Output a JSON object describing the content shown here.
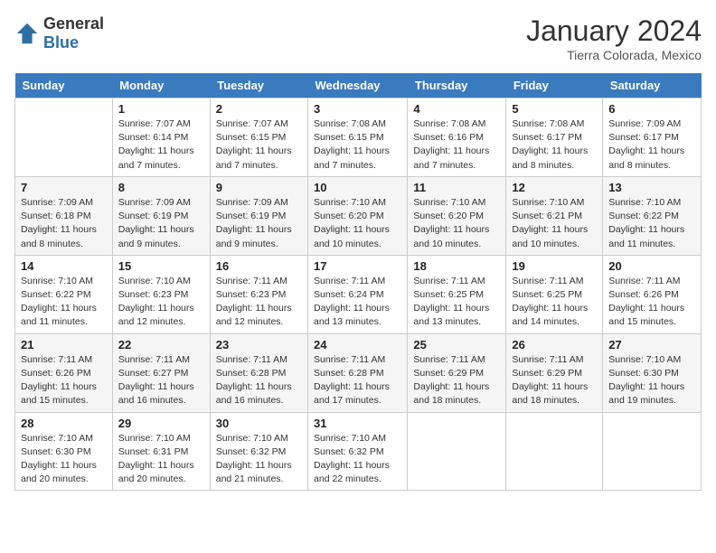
{
  "header": {
    "logo_general": "General",
    "logo_blue": "Blue",
    "month_year": "January 2024",
    "location": "Tierra Colorada, Mexico"
  },
  "weekdays": [
    "Sunday",
    "Monday",
    "Tuesday",
    "Wednesday",
    "Thursday",
    "Friday",
    "Saturday"
  ],
  "weeks": [
    [
      {
        "day": "",
        "info": ""
      },
      {
        "day": "1",
        "info": "Sunrise: 7:07 AM\nSunset: 6:14 PM\nDaylight: 11 hours\nand 7 minutes."
      },
      {
        "day": "2",
        "info": "Sunrise: 7:07 AM\nSunset: 6:15 PM\nDaylight: 11 hours\nand 7 minutes."
      },
      {
        "day": "3",
        "info": "Sunrise: 7:08 AM\nSunset: 6:15 PM\nDaylight: 11 hours\nand 7 minutes."
      },
      {
        "day": "4",
        "info": "Sunrise: 7:08 AM\nSunset: 6:16 PM\nDaylight: 11 hours\nand 7 minutes."
      },
      {
        "day": "5",
        "info": "Sunrise: 7:08 AM\nSunset: 6:17 PM\nDaylight: 11 hours\nand 8 minutes."
      },
      {
        "day": "6",
        "info": "Sunrise: 7:09 AM\nSunset: 6:17 PM\nDaylight: 11 hours\nand 8 minutes."
      }
    ],
    [
      {
        "day": "7",
        "info": "Sunrise: 7:09 AM\nSunset: 6:18 PM\nDaylight: 11 hours\nand 8 minutes."
      },
      {
        "day": "8",
        "info": "Sunrise: 7:09 AM\nSunset: 6:19 PM\nDaylight: 11 hours\nand 9 minutes."
      },
      {
        "day": "9",
        "info": "Sunrise: 7:09 AM\nSunset: 6:19 PM\nDaylight: 11 hours\nand 9 minutes."
      },
      {
        "day": "10",
        "info": "Sunrise: 7:10 AM\nSunset: 6:20 PM\nDaylight: 11 hours\nand 10 minutes."
      },
      {
        "day": "11",
        "info": "Sunrise: 7:10 AM\nSunset: 6:20 PM\nDaylight: 11 hours\nand 10 minutes."
      },
      {
        "day": "12",
        "info": "Sunrise: 7:10 AM\nSunset: 6:21 PM\nDaylight: 11 hours\nand 10 minutes."
      },
      {
        "day": "13",
        "info": "Sunrise: 7:10 AM\nSunset: 6:22 PM\nDaylight: 11 hours\nand 11 minutes."
      }
    ],
    [
      {
        "day": "14",
        "info": "Sunrise: 7:10 AM\nSunset: 6:22 PM\nDaylight: 11 hours\nand 11 minutes."
      },
      {
        "day": "15",
        "info": "Sunrise: 7:10 AM\nSunset: 6:23 PM\nDaylight: 11 hours\nand 12 minutes."
      },
      {
        "day": "16",
        "info": "Sunrise: 7:11 AM\nSunset: 6:23 PM\nDaylight: 11 hours\nand 12 minutes."
      },
      {
        "day": "17",
        "info": "Sunrise: 7:11 AM\nSunset: 6:24 PM\nDaylight: 11 hours\nand 13 minutes."
      },
      {
        "day": "18",
        "info": "Sunrise: 7:11 AM\nSunset: 6:25 PM\nDaylight: 11 hours\nand 13 minutes."
      },
      {
        "day": "19",
        "info": "Sunrise: 7:11 AM\nSunset: 6:25 PM\nDaylight: 11 hours\nand 14 minutes."
      },
      {
        "day": "20",
        "info": "Sunrise: 7:11 AM\nSunset: 6:26 PM\nDaylight: 11 hours\nand 15 minutes."
      }
    ],
    [
      {
        "day": "21",
        "info": "Sunrise: 7:11 AM\nSunset: 6:26 PM\nDaylight: 11 hours\nand 15 minutes."
      },
      {
        "day": "22",
        "info": "Sunrise: 7:11 AM\nSunset: 6:27 PM\nDaylight: 11 hours\nand 16 minutes."
      },
      {
        "day": "23",
        "info": "Sunrise: 7:11 AM\nSunset: 6:28 PM\nDaylight: 11 hours\nand 16 minutes."
      },
      {
        "day": "24",
        "info": "Sunrise: 7:11 AM\nSunset: 6:28 PM\nDaylight: 11 hours\nand 17 minutes."
      },
      {
        "day": "25",
        "info": "Sunrise: 7:11 AM\nSunset: 6:29 PM\nDaylight: 11 hours\nand 18 minutes."
      },
      {
        "day": "26",
        "info": "Sunrise: 7:11 AM\nSunset: 6:29 PM\nDaylight: 11 hours\nand 18 minutes."
      },
      {
        "day": "27",
        "info": "Sunrise: 7:10 AM\nSunset: 6:30 PM\nDaylight: 11 hours\nand 19 minutes."
      }
    ],
    [
      {
        "day": "28",
        "info": "Sunrise: 7:10 AM\nSunset: 6:30 PM\nDaylight: 11 hours\nand 20 minutes."
      },
      {
        "day": "29",
        "info": "Sunrise: 7:10 AM\nSunset: 6:31 PM\nDaylight: 11 hours\nand 20 minutes."
      },
      {
        "day": "30",
        "info": "Sunrise: 7:10 AM\nSunset: 6:32 PM\nDaylight: 11 hours\nand 21 minutes."
      },
      {
        "day": "31",
        "info": "Sunrise: 7:10 AM\nSunset: 6:32 PM\nDaylight: 11 hours\nand 22 minutes."
      },
      {
        "day": "",
        "info": ""
      },
      {
        "day": "",
        "info": ""
      },
      {
        "day": "",
        "info": ""
      }
    ]
  ]
}
